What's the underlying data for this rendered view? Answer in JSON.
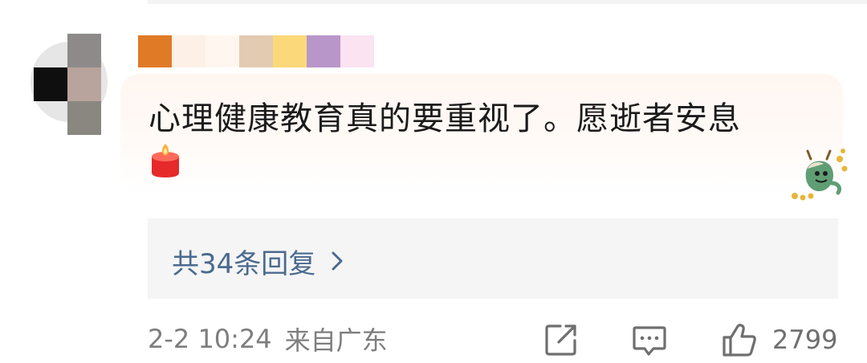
{
  "comment": {
    "text": "心理健康教育真的要重视了。愿逝者安息",
    "emoji_icon": "candle-icon",
    "decoration_icon": "dragon-mascot-icon"
  },
  "replies": {
    "label": "共34条回复",
    "chevron_icon": "chevron-right-icon"
  },
  "meta": {
    "time": "2-2 10:24",
    "location": "来自广东"
  },
  "actions": {
    "share_icon": "share-icon",
    "reply_icon": "comment-icon",
    "like_icon": "thumbs-up-icon",
    "like_count": "2799"
  },
  "colors": {
    "text": "#1b1b1b",
    "link": "#4a6a8e",
    "meta": "#7e7e7e",
    "reply_bg": "#f5f5f5",
    "bubble_bg": "#fff6f1"
  },
  "redacted": {
    "avatar_pixels": [
      "#8e8a8a",
      "#0f0f0f",
      "#b8a49c",
      "#8a8780"
    ],
    "nickname_pixels": [
      "#e07a26",
      "#fdf0e7",
      "#fff7ef",
      "#e3cab2",
      "#fbd879",
      "#b996c9",
      "#fbe3f2"
    ]
  }
}
